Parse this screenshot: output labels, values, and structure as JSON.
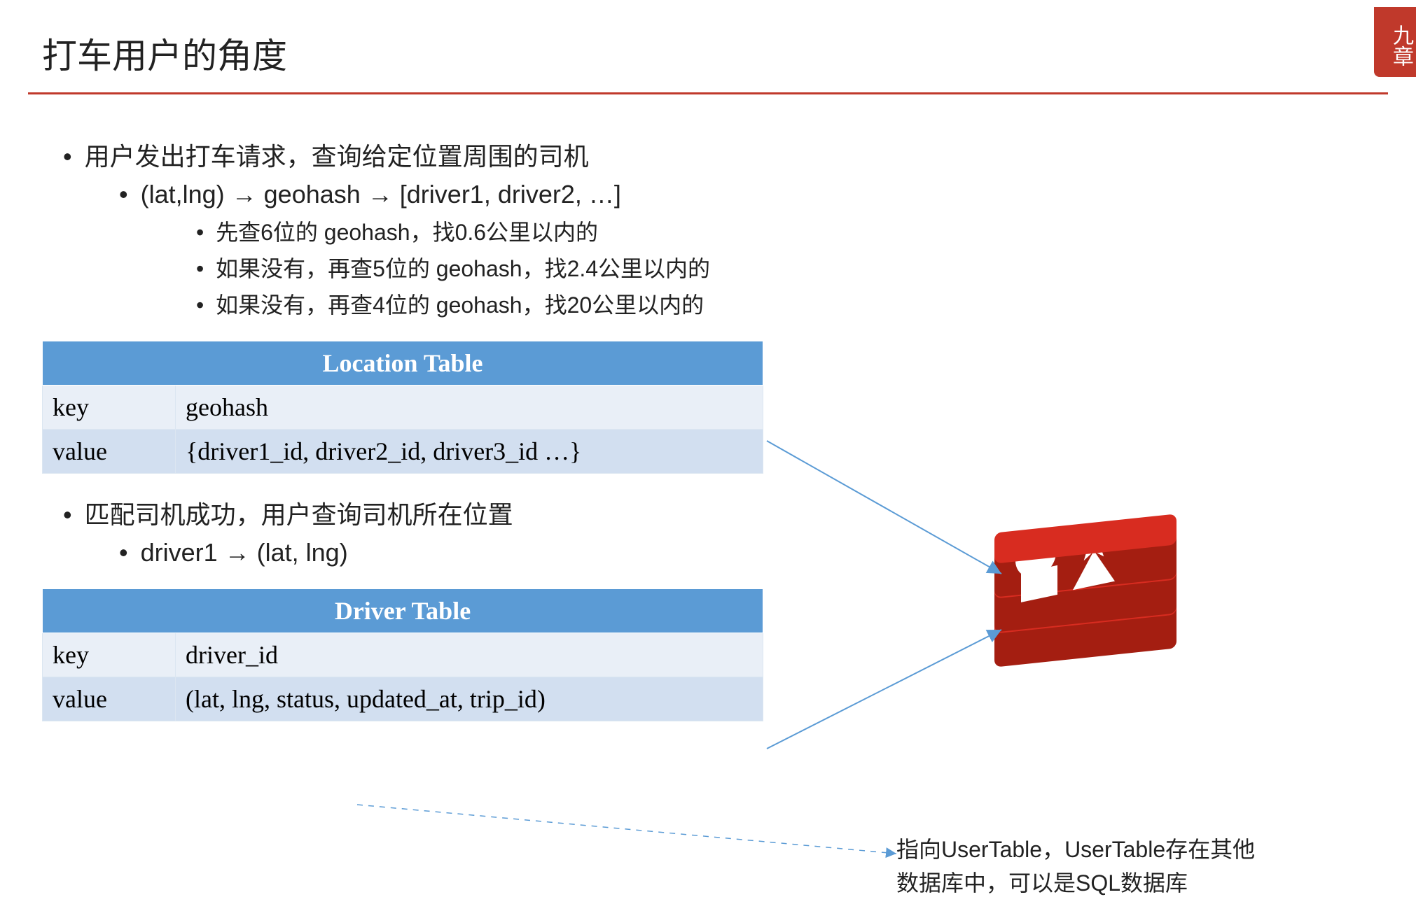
{
  "title": "打车用户的角度",
  "section1": {
    "heading": "用户发出打车请求，查询给定位置周围的司机",
    "sub": "(lat,lng) → geohash → [driver1, driver2, …]",
    "items": [
      "先查6位的 geohash，找0.6公里以内的",
      "如果没有，再查5位的 geohash，找2.4公里以内的",
      "如果没有，再查4位的 geohash，找20公里以内的"
    ]
  },
  "locationTable": {
    "title": "Location Table",
    "rows": [
      {
        "k": "key",
        "v": "geohash"
      },
      {
        "k": "value",
        "v": "{driver1_id, driver2_id, driver3_id …}"
      }
    ]
  },
  "section2": {
    "heading": "匹配司机成功，用户查询司机所在位置",
    "sub": "driver1 → (lat, lng)"
  },
  "driverTable": {
    "title": "Driver Table",
    "rows": [
      {
        "k": "key",
        "v": "driver_id"
      },
      {
        "k": "value",
        "v": "(lat, lng, status, updated_at, trip_id)"
      }
    ]
  },
  "note": {
    "line1": "指向UserTable，UserTable存在其他",
    "line2": "数据库中，可以是SQL数据库"
  },
  "logoText": "九章"
}
